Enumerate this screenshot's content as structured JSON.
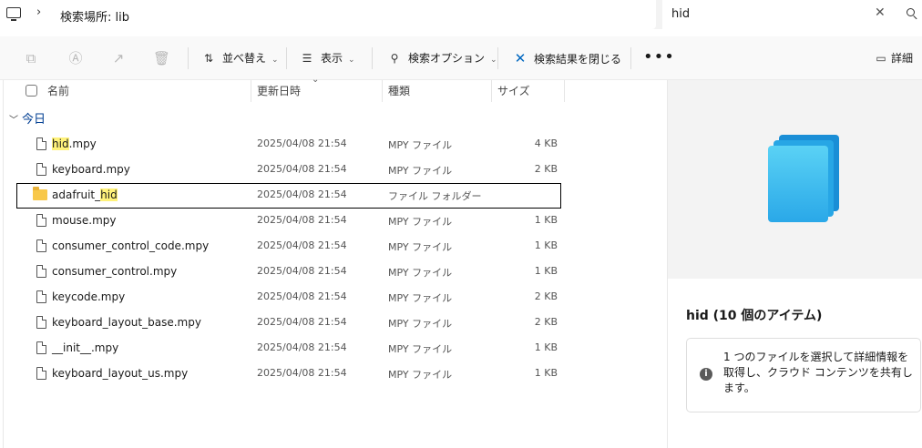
{
  "address": {
    "chevron": "›",
    "path": "検索場所: lib"
  },
  "search": {
    "query": "hid",
    "clear_glyph": "✕"
  },
  "toolbar": {
    "sort_label": "並べ替え",
    "view_label": "表示",
    "search_options_label": "検索オプション",
    "close_search_label": "検索結果を閉じる",
    "more_label": "•••",
    "details_label": "詳細",
    "icons": [
      "copy-icon",
      "rename-icon",
      "share-icon",
      "delete-icon",
      "sort-icon",
      "view-icon",
      "search-options-icon",
      "close-icon",
      "more-icon",
      "details-pane-icon"
    ]
  },
  "columns": {
    "name": "名前",
    "date": "更新日時",
    "type": "種類",
    "size": "サイズ"
  },
  "group": {
    "label": "今日"
  },
  "files": [
    {
      "pre": "",
      "hl": "hid",
      "post": ".mpy",
      "date": "2025/04/08 21:54",
      "type": "MPY ファイル",
      "size": "4 KB",
      "kind": "file"
    },
    {
      "pre": "keyboard.mpy",
      "hl": "",
      "post": "",
      "date": "2025/04/08 21:54",
      "type": "MPY ファイル",
      "size": "2 KB",
      "kind": "file"
    },
    {
      "pre": "adafruit_",
      "hl": "hid",
      "post": "",
      "date": "2025/04/08 21:54",
      "type": "ファイル フォルダー",
      "size": "",
      "kind": "folder"
    },
    {
      "pre": "mouse.mpy",
      "hl": "",
      "post": "",
      "date": "2025/04/08 21:54",
      "type": "MPY ファイル",
      "size": "1 KB",
      "kind": "file"
    },
    {
      "pre": "consumer_control_code.mpy",
      "hl": "",
      "post": "",
      "date": "2025/04/08 21:54",
      "type": "MPY ファイル",
      "size": "1 KB",
      "kind": "file"
    },
    {
      "pre": "consumer_control.mpy",
      "hl": "",
      "post": "",
      "date": "2025/04/08 21:54",
      "type": "MPY ファイル",
      "size": "1 KB",
      "kind": "file"
    },
    {
      "pre": "keycode.mpy",
      "hl": "",
      "post": "",
      "date": "2025/04/08 21:54",
      "type": "MPY ファイル",
      "size": "2 KB",
      "kind": "file"
    },
    {
      "pre": "keyboard_layout_base.mpy",
      "hl": "",
      "post": "",
      "date": "2025/04/08 21:54",
      "type": "MPY ファイル",
      "size": "2 KB",
      "kind": "file"
    },
    {
      "pre": "__init__.mpy",
      "hl": "",
      "post": "",
      "date": "2025/04/08 21:54",
      "type": "MPY ファイル",
      "size": "1 KB",
      "kind": "file"
    },
    {
      "pre": "keyboard_layout_us.mpy",
      "hl": "",
      "post": "",
      "date": "2025/04/08 21:54",
      "type": "MPY ファイル",
      "size": "1 KB",
      "kind": "file"
    }
  ],
  "details": {
    "title": "hid (10 個のアイテム)",
    "info_text": "1 つのファイルを選択して詳細情報を取得し、クラウド コンテンツを共有します。"
  }
}
